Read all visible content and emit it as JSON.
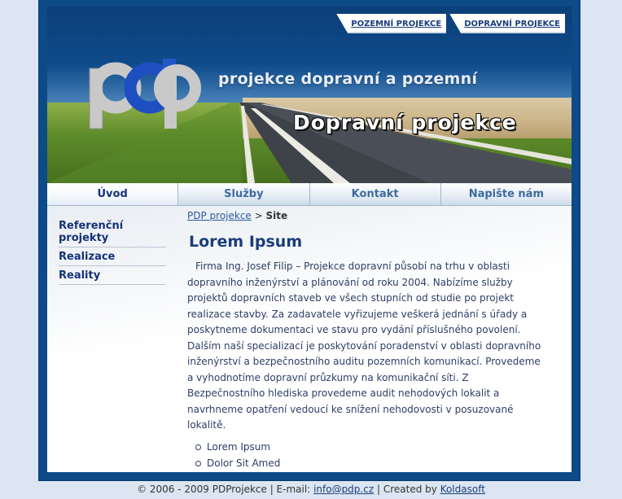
{
  "top_links": [
    "POZEMNÍ PROJEKCE",
    "DOPRAVNÍ PROJEKCE"
  ],
  "logo_text": "pdp",
  "tagline": "projekce dopravní a pozemní",
  "banner_title": "Dopravní projekce",
  "nav": [
    "Úvod",
    "Služby",
    "Kontakt",
    "Napište nám"
  ],
  "sidebar": [
    "Referenční projekty",
    "Realizace",
    "Reality"
  ],
  "breadcrumb": {
    "link": "PDP projekce",
    "separator": ">",
    "current": "Site"
  },
  "heading": "Lorem Ipsum",
  "paragraph": "Firma Ing. Josef Filip – Projekce dopravní působí na trhu v oblasti dopravního inženýrství a plánování od roku 2004. Nabízíme služby projektů dopravních staveb ve všech stupních od studie po projekt realizace stavby. Za zadavatele vyřizujeme veškerá jednání s úřady a poskytneme dokumentaci ve stavu pro vydání příslušného povolení. Dalším naší specializací je poskytování poradenství v oblasti dopravního inženýrství a bezpečnostního auditu pozemních komunikací. Provedeme a vyhodnotíme dopravní průzkumy na komunikační síti. Z Bezpečnostního hlediska provedeme audit nehodových lokalit a navrhneme opatření vedoucí ke snížení nehodovosti v posuzované lokalitě.",
  "bullets": [
    "Lorem Ipsum",
    "Dolor Sit Amed"
  ],
  "footer": {
    "prefix": "© 2006 - 2009 PDProjekce | E-mail:",
    "email": "info@pdp.cz",
    "middle": "| Created by",
    "author": "Koldasoft"
  },
  "colors": {
    "frame": "#0d4a86",
    "nav_text": "#3d6aa0",
    "link": "#1a3d7a"
  }
}
